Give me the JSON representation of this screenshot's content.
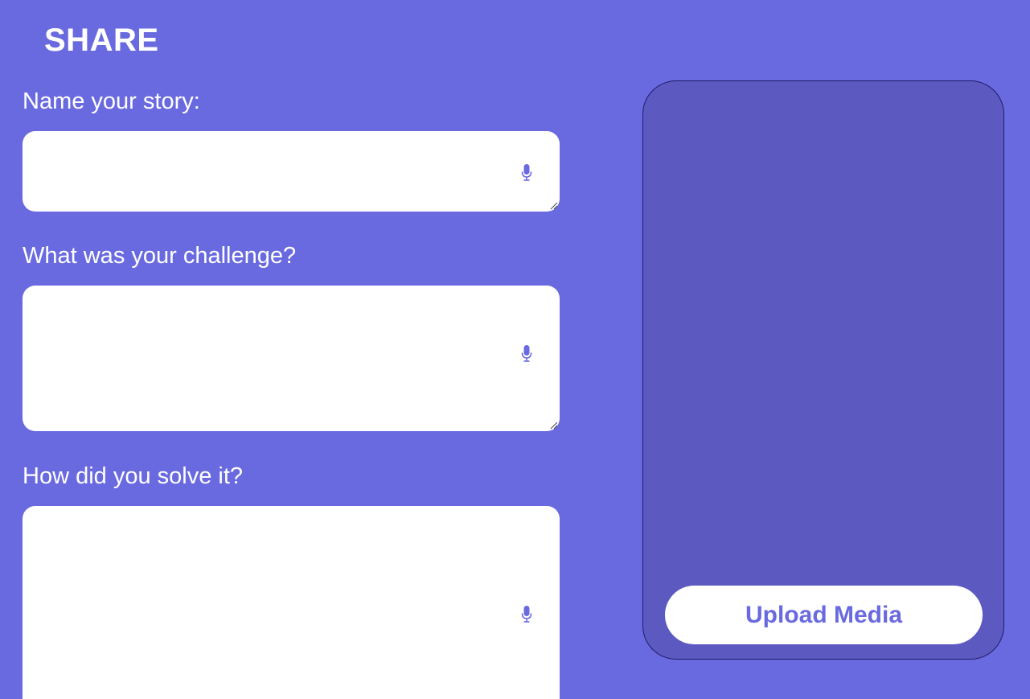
{
  "header": {
    "title": "SHARE"
  },
  "form": {
    "fields": [
      {
        "label": "Name your story:",
        "value": "",
        "placeholder": "",
        "mic_icon": "microphone-icon"
      },
      {
        "label": "What was your challenge?",
        "value": "",
        "placeholder": "",
        "mic_icon": "microphone-icon"
      },
      {
        "label": "How did you solve it?",
        "value": "",
        "placeholder": "",
        "mic_icon": "microphone-icon"
      }
    ]
  },
  "media": {
    "upload_label": "Upload Media"
  },
  "colors": {
    "background": "#6A6AE0",
    "panel": "#5C5AC0",
    "panel_border": "#1E1C6A",
    "accent": "#6A6AE0",
    "field_bg": "#FFFFFF",
    "text": "#FFFFFF"
  }
}
